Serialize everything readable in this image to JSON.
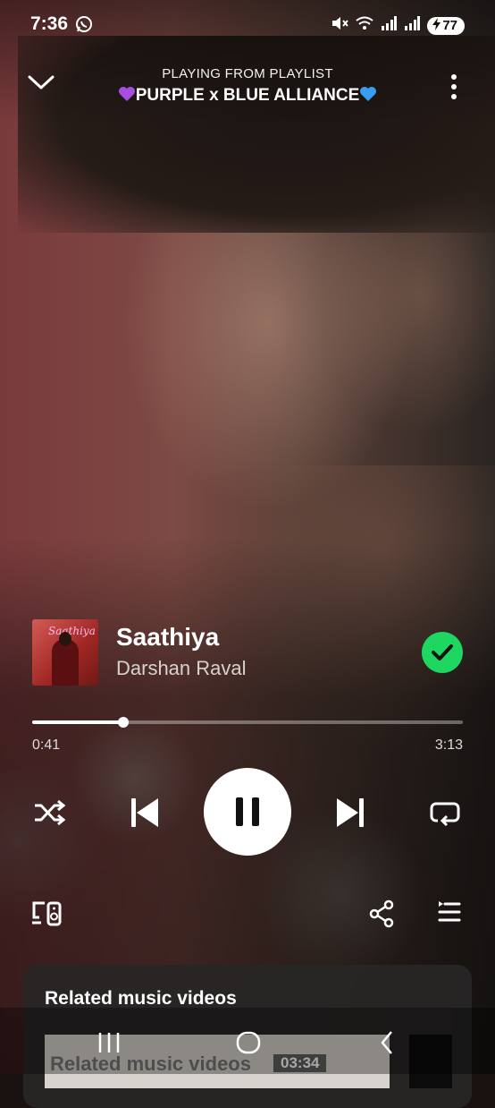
{
  "status_bar": {
    "time": "7:36",
    "battery": "77"
  },
  "header": {
    "subtitle": "PLAYING FROM PLAYLIST",
    "playlist_name": "PURPLE x BLUE ALLIANCE",
    "left_emoji": "purple-heart",
    "right_emoji": "blue-heart"
  },
  "album_art": {
    "script_text": "Saathiya"
  },
  "track": {
    "title": "Saathiya",
    "artist": "Darshan Raval",
    "liked": true
  },
  "progress": {
    "elapsed": "0:41",
    "total": "3:13",
    "fraction": 0.212
  },
  "playback": {
    "state": "playing",
    "shuffle": "off",
    "repeat": "off"
  },
  "related": {
    "title": "Related music videos",
    "thumb_text": "Related music videos",
    "duration": "03:34"
  },
  "colors": {
    "accent": "#1ed760",
    "purple_heart": "#a64ee0",
    "blue_heart": "#3a9cf0"
  }
}
